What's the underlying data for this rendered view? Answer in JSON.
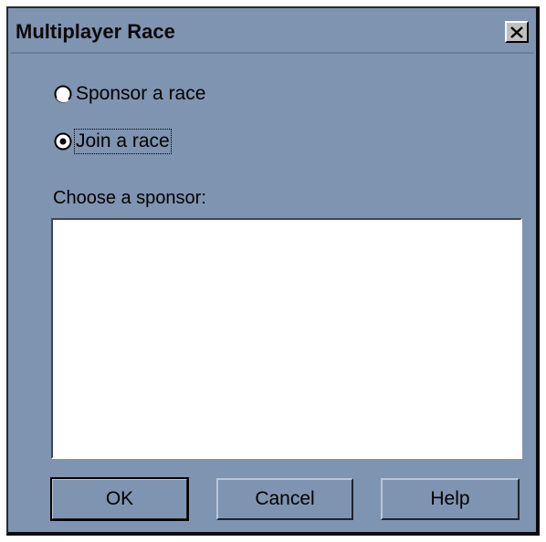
{
  "dialog": {
    "title": "Multiplayer Race",
    "close_icon": "close-icon"
  },
  "options": {
    "sponsor": {
      "label": "Sponsor a race",
      "selected": false
    },
    "join": {
      "label": "Join a race",
      "selected": true
    }
  },
  "sponsor_list": {
    "label": "Choose a sponsor:",
    "items": []
  },
  "buttons": {
    "ok": "OK",
    "cancel": "Cancel",
    "help": "Help"
  },
  "colors": {
    "dialog_bg": "#7f94b0",
    "list_bg": "#ffffff"
  }
}
